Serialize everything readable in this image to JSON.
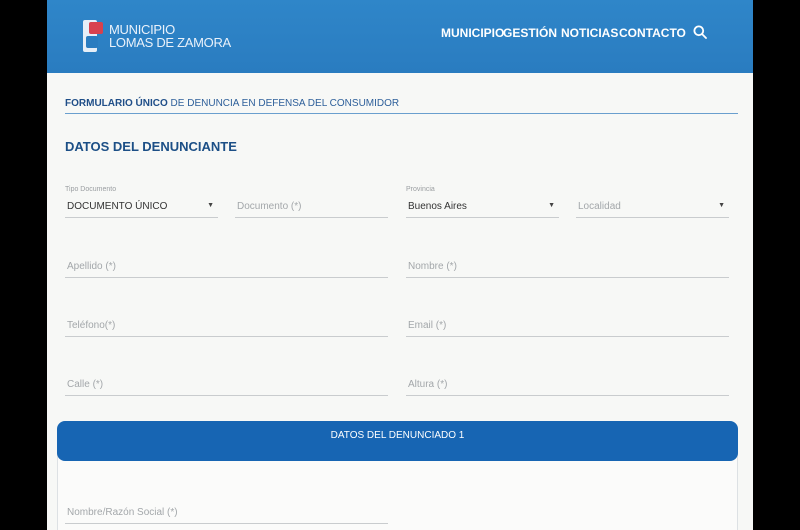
{
  "header": {
    "logo_line1": "MUNICIPIO",
    "logo_line2": "LOMAS DE ZAMORA",
    "nav": [
      "MUNICIPIO",
      "GESTIÓN",
      "NOTICIAS",
      "CONTACTO"
    ]
  },
  "breadcrumb": {
    "strong": "FORMULARIO ÚNICO",
    "rest": " DE DENUNCIA EN DEFENSA DEL CONSUMIDOR"
  },
  "section_title": "DATOS DEL DENUNCIANTE",
  "form": {
    "tipo_documento": {
      "label": "Tipo Documento",
      "value": "DOCUMENTO ÚNICO"
    },
    "documento": {
      "placeholder": "Documento (*)"
    },
    "provincia": {
      "label": "Provincia",
      "value": "Buenos Aires"
    },
    "localidad": {
      "placeholder": "Localidad"
    },
    "apellido": {
      "placeholder": "Apellido (*)"
    },
    "nombre": {
      "placeholder": "Nombre (*)"
    },
    "telefono": {
      "placeholder": "Teléfono(*)"
    },
    "email": {
      "placeholder": "Email (*)"
    },
    "calle": {
      "placeholder": "Calle (*)"
    },
    "altura": {
      "placeholder": "Altura (*)"
    }
  },
  "denunciado": {
    "bar_title": "DATOS DEL DENUNCIADO 1",
    "nombre_razon": {
      "placeholder": "Nombre/Razón Social (*)"
    }
  },
  "colors": {
    "header_blue": "#2f86c9",
    "bar_blue": "#1765b3",
    "title_blue": "#1c4f86"
  },
  "icons": {
    "search": "search-icon",
    "dropdown": "chevron-down-icon"
  }
}
